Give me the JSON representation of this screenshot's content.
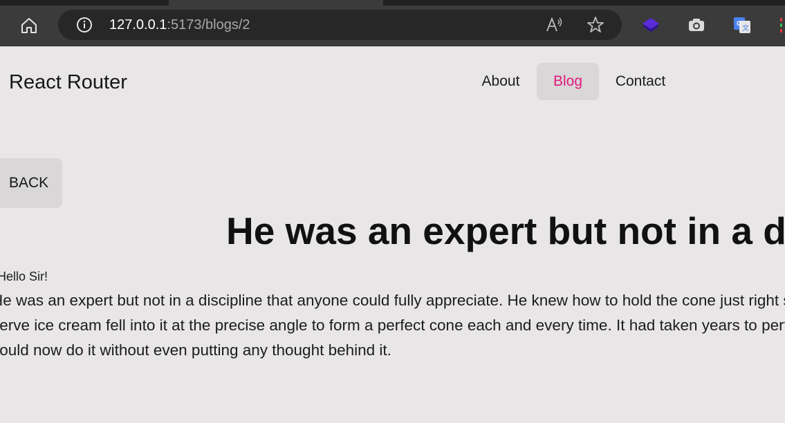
{
  "browser": {
    "url_host": "127.0.0.1",
    "url_rest": ":5173/blogs/2",
    "icons": [
      "home-icon",
      "info-icon",
      "read-aloud-icon",
      "favorite-star-icon",
      "layers-extension-icon",
      "camera-extension-icon",
      "translate-extension-icon"
    ]
  },
  "navbar": {
    "brand": "React Router",
    "links": [
      {
        "label": "About"
      },
      {
        "label": "Blog",
        "active": true
      },
      {
        "label": "Contact"
      }
    ],
    "active_color": "#e0197a"
  },
  "post": {
    "back_label": "BACK",
    "title": "He was an expert but not in a discipline that anyone could fully appreciate.",
    "greeting": "Hello Sir!",
    "body": "He was an expert but not in a discipline that anyone could fully appreciate. He knew how to hold the cone just right so that the soft serve ice cream fell into it at the precise angle to form a perfect cone each and every time. It had taken years to perfect and he could now do it without even putting any thought behind it."
  }
}
